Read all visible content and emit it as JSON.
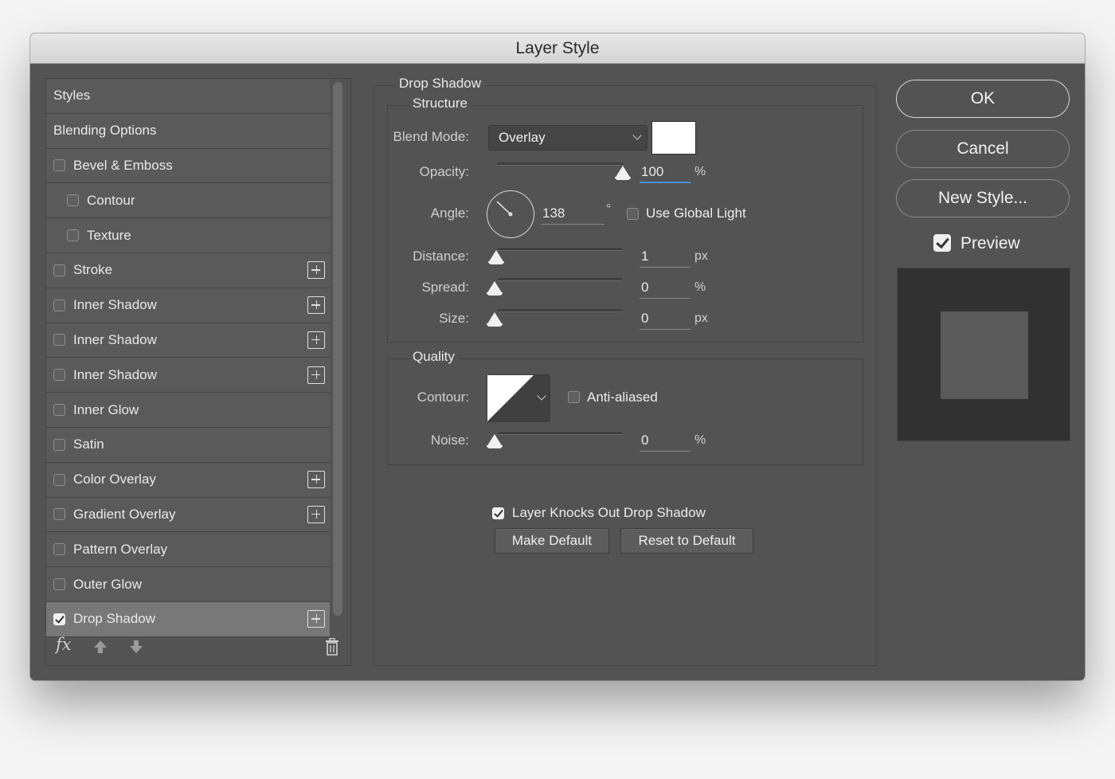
{
  "window": {
    "title": "Layer Style"
  },
  "styles_list": [
    {
      "label": "Styles",
      "type": "header",
      "checked": null,
      "has_plus": false
    },
    {
      "label": "Blending Options",
      "type": "header",
      "checked": null,
      "has_plus": false
    },
    {
      "label": "Bevel & Emboss",
      "type": "item",
      "checked": false,
      "has_plus": false
    },
    {
      "label": "Contour",
      "type": "sub",
      "checked": false,
      "has_plus": false
    },
    {
      "label": "Texture",
      "type": "sub",
      "checked": false,
      "has_plus": false
    },
    {
      "label": "Stroke",
      "type": "item",
      "checked": false,
      "has_plus": true
    },
    {
      "label": "Inner Shadow",
      "type": "item",
      "checked": false,
      "has_plus": true
    },
    {
      "label": "Inner Shadow",
      "type": "item",
      "checked": false,
      "has_plus": true
    },
    {
      "label": "Inner Shadow",
      "type": "item",
      "checked": false,
      "has_plus": true
    },
    {
      "label": "Inner Glow",
      "type": "item",
      "checked": false,
      "has_plus": false
    },
    {
      "label": "Satin",
      "type": "item",
      "checked": false,
      "has_plus": false
    },
    {
      "label": "Color Overlay",
      "type": "item",
      "checked": false,
      "has_plus": true
    },
    {
      "label": "Gradient Overlay",
      "type": "item",
      "checked": false,
      "has_plus": true
    },
    {
      "label": "Pattern Overlay",
      "type": "item",
      "checked": false,
      "has_plus": false
    },
    {
      "label": "Outer Glow",
      "type": "item",
      "checked": false,
      "has_plus": false
    },
    {
      "label": "Drop Shadow",
      "type": "item",
      "checked": true,
      "has_plus": true,
      "selected": true
    }
  ],
  "footer": {
    "fx_label": "fx"
  },
  "drop_shadow": {
    "section_title": "Drop Shadow",
    "structure": {
      "title": "Structure",
      "blend_mode_label": "Blend Mode:",
      "blend_mode_value": "Overlay",
      "color": "#ffffff",
      "opacity_label": "Opacity:",
      "opacity_value": "100",
      "opacity_unit": "%",
      "angle_label": "Angle:",
      "angle_value": "138",
      "angle_unit": "°",
      "use_global_light_label": "Use Global Light",
      "use_global_light": false,
      "distance_label": "Distance:",
      "distance_value": "1",
      "distance_unit": "px",
      "spread_label": "Spread:",
      "spread_value": "0",
      "spread_unit": "%",
      "size_label": "Size:",
      "size_value": "0",
      "size_unit": "px"
    },
    "quality": {
      "title": "Quality",
      "contour_label": "Contour:",
      "anti_aliased_label": "Anti-aliased",
      "anti_aliased": false,
      "noise_label": "Noise:",
      "noise_value": "0",
      "noise_unit": "%"
    },
    "knocks_out_label": "Layer Knocks Out Drop Shadow",
    "knocks_out": true,
    "make_default_label": "Make Default",
    "reset_default_label": "Reset to Default"
  },
  "actions": {
    "ok_label": "OK",
    "cancel_label": "Cancel",
    "new_style_label": "New Style...",
    "preview_label": "Preview",
    "preview_checked": true
  },
  "colors": {
    "panel": "#535353",
    "titlebar": "#dcdcdc",
    "selected_row": "#787878"
  }
}
